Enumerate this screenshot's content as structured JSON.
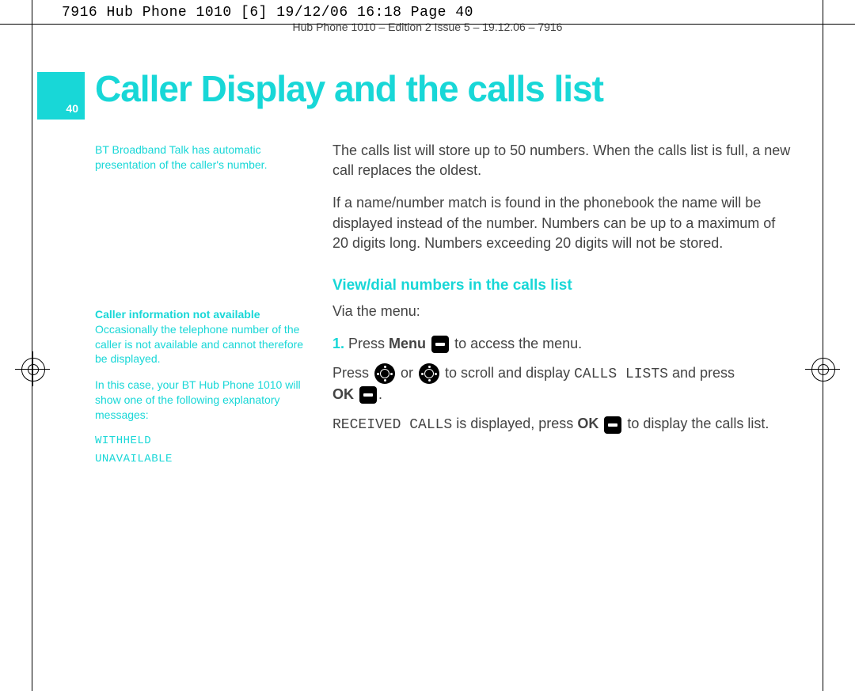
{
  "header": {
    "line": "7916 Hub Phone 1010 [6]  19/12/06  16:18  Page 40",
    "subline": "Hub Phone 1010 – Edition 2   Issue 5 – 19.12.06 – 7916"
  },
  "page_number": "40",
  "title": "Caller Display and the calls list",
  "sidebar": {
    "note1": "BT Broadband Talk has automatic presentation of the caller's number.",
    "sec_title": "Caller information not available",
    "para1": "Occasionally the telephone number of the caller is not available and cannot therefore be displayed.",
    "para2": "In this case, your BT Hub Phone 1010 will show one of the following explanatory messages:",
    "msg1": "WITHHELD",
    "msg2": "UNAVAILABLE"
  },
  "body": {
    "p1": "The calls list will store up to 50 numbers. When the calls list is full, a new call replaces the oldest.",
    "p2": "If a name/number match is found in the phonebook the name will be displayed instead of the number. Numbers can be up to a maximum of 20 digits long. Numbers exceeding 20 digits will not be stored.",
    "sub_title": "View/dial numbers in the calls list",
    "via": "Via the menu:",
    "step1_num": "1.",
    "step1_a": "Press ",
    "step1_menu": "Menu",
    "step1_b": " to access the menu.",
    "step2_a": "Press ",
    "step2_b": " or ",
    "step2_c": " to scroll and display ",
    "step2_calls": "CALLS LISTS",
    "step2_d": " and press ",
    "step2_ok": "OK",
    "step2_e": ".",
    "step3_rec": "RECEIVED CALLS",
    "step3_a": " is displayed, press ",
    "step3_ok": "OK",
    "step3_b": " to display the calls list."
  }
}
